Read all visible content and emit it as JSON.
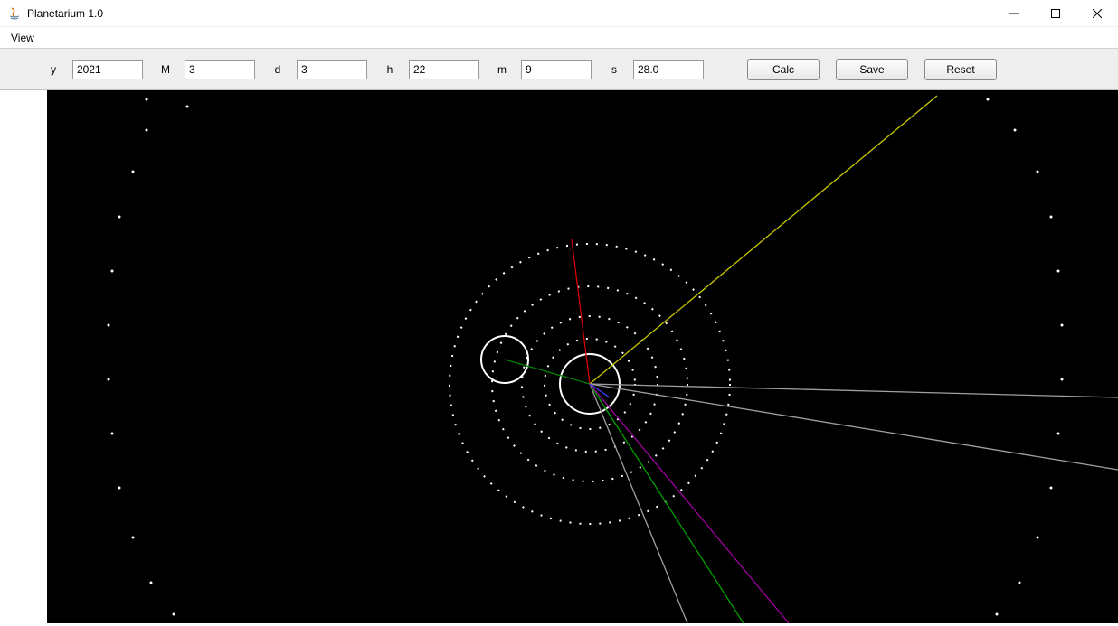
{
  "window": {
    "title": "Planetarium 1.0"
  },
  "menu": {
    "view": "View"
  },
  "toolbar": {
    "labels": {
      "y": "y",
      "M": "M",
      "d": "d",
      "h": "h",
      "m": "m",
      "s": "s"
    },
    "values": {
      "y": "2021",
      "M": "3",
      "d": "3",
      "h": "22",
      "m": "9",
      "s": "28.0"
    },
    "buttons": {
      "calc": "Calc",
      "save": "Save",
      "reset": "Reset"
    }
  }
}
